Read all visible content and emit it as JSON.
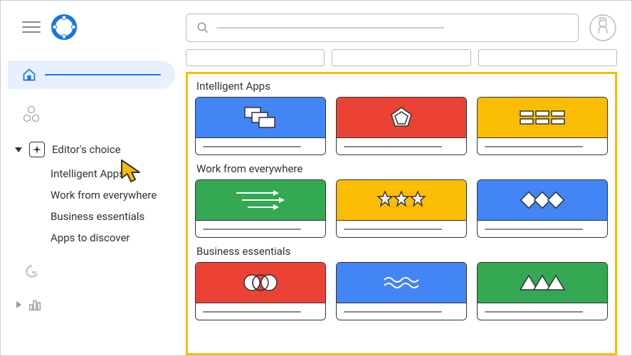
{
  "sidebar": {
    "editors_choice": "Editor's choice",
    "categories": [
      {
        "label": "Intelligent Apps"
      },
      {
        "label": "Work from everywhere"
      },
      {
        "label": "Business essentials"
      },
      {
        "label": "Apps to discover"
      }
    ]
  },
  "sections": [
    {
      "title": "Intelligent Apps"
    },
    {
      "title": "Work from everywhere"
    },
    {
      "title": "Business essentials"
    }
  ],
  "colors": {
    "blue": "#4285f4",
    "red": "#ea4335",
    "yellow": "#fbbc04",
    "green": "#34a853",
    "highlight": "#fbbc04"
  }
}
